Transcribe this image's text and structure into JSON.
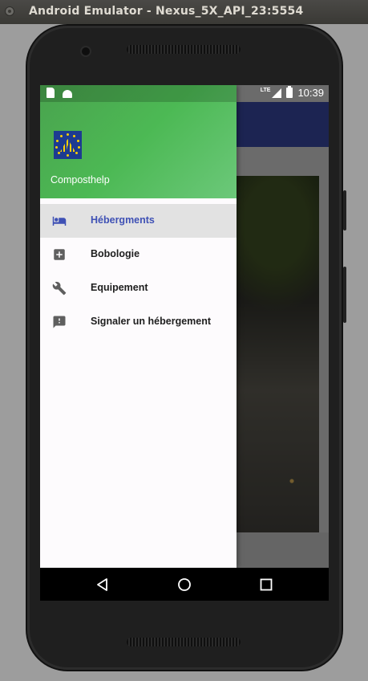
{
  "window": {
    "title": "Android Emulator - Nexus_5X_API_23:5554"
  },
  "status_bar": {
    "network": "LTE",
    "time": "10:39"
  },
  "drawer": {
    "app_name": "Composthelp",
    "items": [
      {
        "label": "Hébergments",
        "icon": "bed-icon",
        "active": true
      },
      {
        "label": "Bobologie",
        "icon": "medical-plus-icon",
        "active": false
      },
      {
        "label": "Equipement",
        "icon": "wrench-icon",
        "active": false
      },
      {
        "label": "Signaler un hébergement",
        "icon": "feedback-icon",
        "active": false
      }
    ]
  },
  "colors": {
    "primary": "#3f51b5",
    "drawer_header": "#4cb954",
    "active_item_bg": "#e2e2e2",
    "icon": "#5f5f5f"
  },
  "navigation": {
    "back": "back-icon",
    "home": "home-icon",
    "recents": "recents-icon"
  }
}
